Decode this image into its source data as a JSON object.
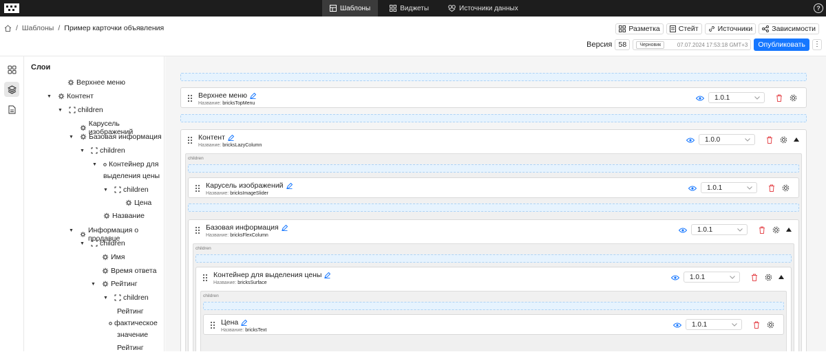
{
  "topnav": {
    "tabs": [
      "Шаблоны",
      "Виджеты",
      "Источники данных"
    ]
  },
  "breadcrumb": {
    "items": [
      "Шаблоны",
      "Пример карточки объявления"
    ]
  },
  "actions": [
    "Разметка",
    "Стейт",
    "Источники",
    "Зависимости"
  ],
  "version": {
    "label": "Версия",
    "number": "58",
    "status": "Черновик",
    "date": "07.07.2024 17:53:18 GMT+3",
    "publish": "Опубликовать"
  },
  "layers": {
    "title": "Слои",
    "nodes": [
      "Верхнее меню",
      "Контент",
      "children",
      "Карусель изображений",
      "Базовая информация",
      "children",
      "Контейнер для",
      "выделения цены",
      "children",
      "Цена",
      "Название",
      "Информация о продавце",
      "children",
      "Имя",
      "Время ответа",
      "Рейтинг",
      "children",
      "Рейтинг",
      "фактическое",
      "значение",
      "Рейтинг"
    ]
  },
  "canvas": {
    "name_prefix": "Название:",
    "children_label": "children",
    "blocks": [
      {
        "title": "Верхнее меню",
        "name": "bricksTopMenu",
        "version": "1.0.1"
      },
      {
        "title": "Контент",
        "name": "bricksLazyColumn",
        "version": "1.0.0"
      },
      {
        "title": "Карусель изображений",
        "name": "bricksImageSlider",
        "version": "1.0.1"
      },
      {
        "title": "Базовая информация",
        "name": "bricksFlexColumn",
        "version": "1.0.1"
      },
      {
        "title": "Контейнер для выделения цены",
        "name": "bricksSurface",
        "version": "1.0.1"
      },
      {
        "title": "Цена",
        "name": "bricksText",
        "version": "1.0.1"
      }
    ]
  },
  "colors": {
    "accent": "#1677ff",
    "danger": "#e5484d",
    "topbar": "#1d1d1d"
  }
}
